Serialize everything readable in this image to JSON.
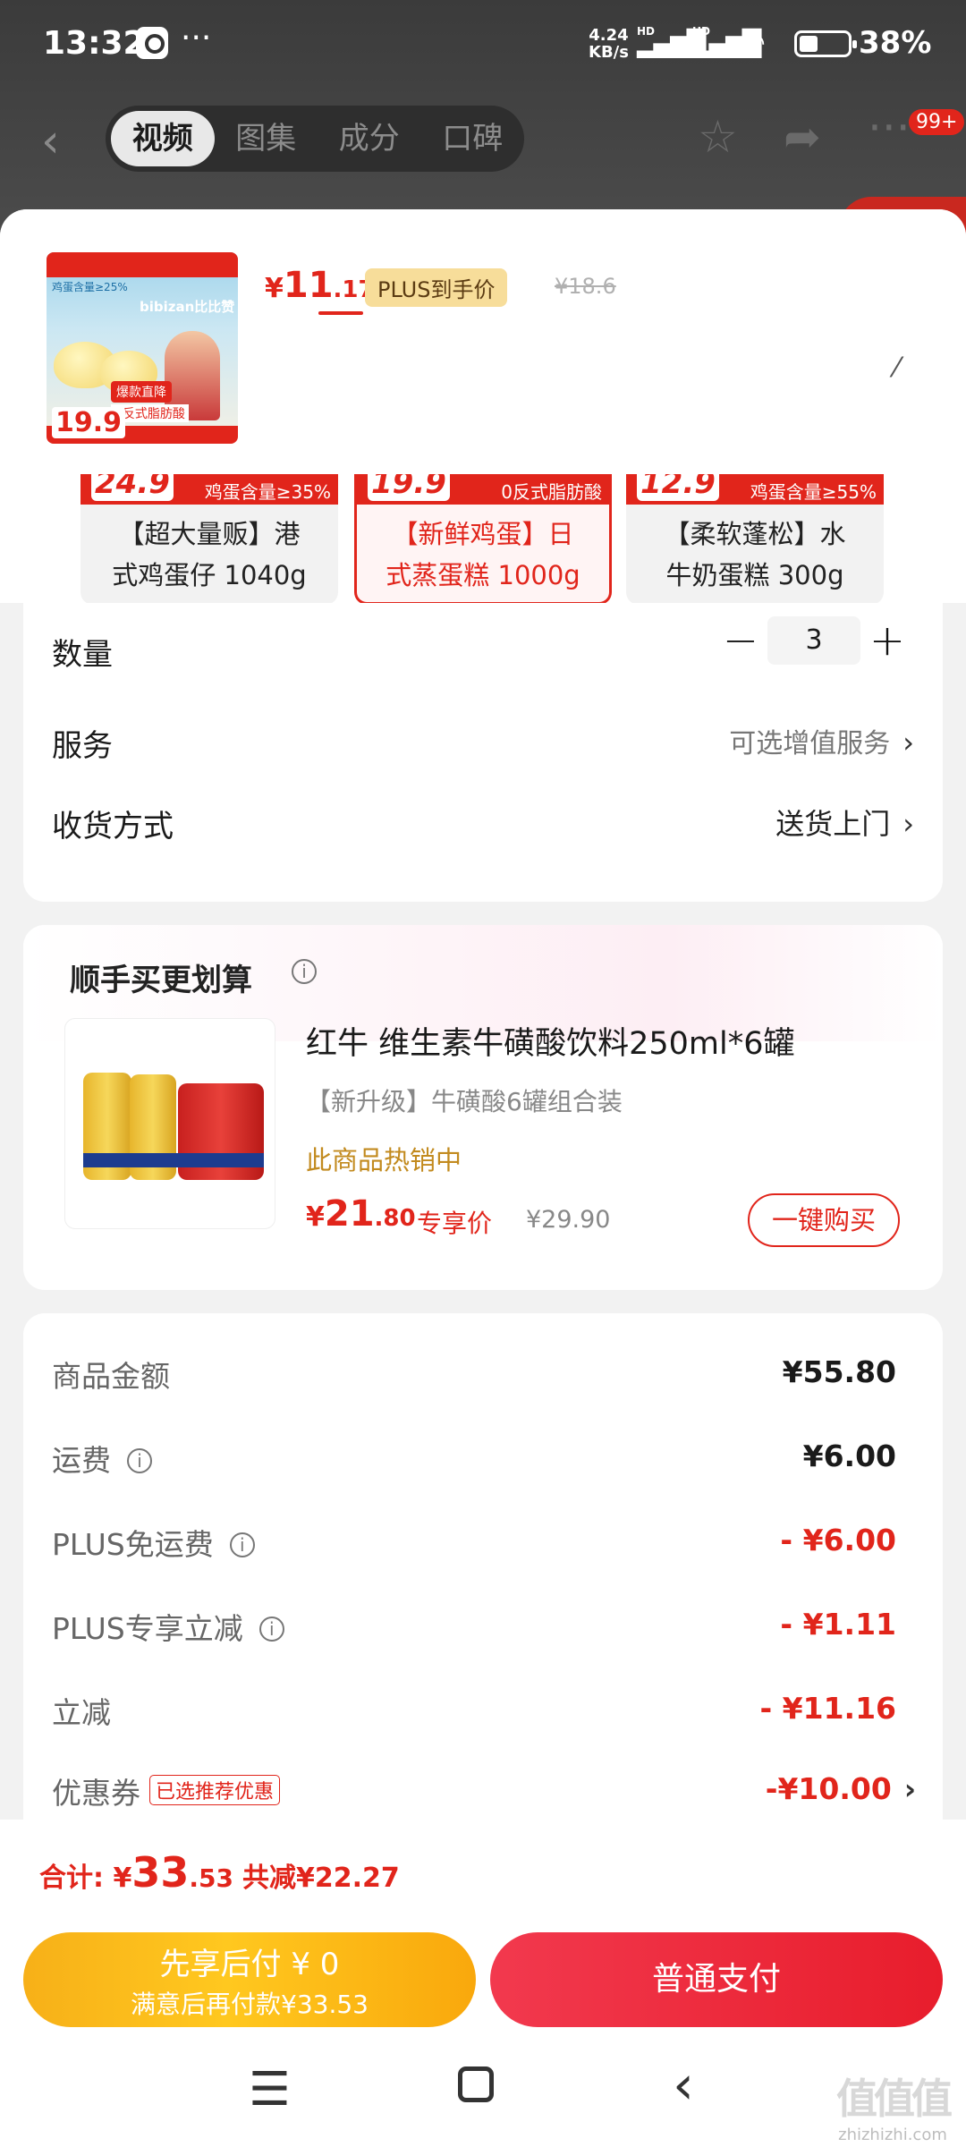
{
  "status": {
    "time": "13:32",
    "dots": "···",
    "speed_top": "4.24",
    "speed_bottom": "KB/s",
    "hd1": "HD",
    "hd2": "HD",
    "wifi_sub": "6",
    "battery": "38%"
  },
  "nav": {
    "tabs": [
      "视频",
      "图集",
      "成分",
      "口碑"
    ],
    "badge": "99+",
    "back_icon": "chevron-left-icon",
    "star_icon": "star-icon",
    "share_icon": "share-icon",
    "more_icon": "more-icon"
  },
  "header": {
    "thumb_price": "19.9",
    "thumb_brand": "bibizan比比赞",
    "thumb_tag": "爆款直降",
    "thumb_sub": "0反式脂肪酸",
    "thumb_badge": "鸡蛋含量≥25%",
    "price_yen": "¥",
    "price_int": "11",
    "price_dec": ".17",
    "plus_label": "PLUS到手价",
    "orig_price": "¥18.6"
  },
  "variants": [
    {
      "num": "24.9",
      "tag": "鸡蛋含量≥35%",
      "name_line1": "【超大量贩】港",
      "name_line2": "式鸡蛋仔 1040g",
      "selected": false
    },
    {
      "num": "19.9",
      "tag": "0反式脂肪酸",
      "name_line1": "【新鲜鸡蛋】日",
      "name_line2": "式蒸蛋糕 1000g",
      "selected": true
    },
    {
      "num": "12.9",
      "tag": "鸡蛋含量≥55%",
      "name_line1": "【柔软蓬松】水",
      "name_line2": "牛奶蛋糕 300g",
      "selected": false
    }
  ],
  "quantity": {
    "label": "数量",
    "minus": "−",
    "value": "3",
    "plus": "+"
  },
  "service": {
    "label": "服务",
    "value": "可选增值服务",
    "chevron": "›"
  },
  "delivery": {
    "label": "收货方式",
    "value": "送货上门",
    "chevron": "›"
  },
  "addon": {
    "title": "顺手买更划算",
    "info": "i",
    "name": "红牛 维生素牛磺酸饮料250ml*6罐",
    "sub": "【新升级】牛磺酸6罐组合装",
    "hot": "此商品热销中",
    "price_yen": "¥",
    "price_int": "21",
    "price_dec": ".80",
    "excl": "专享价",
    "orig": "¥29.90",
    "buy": "一键购买"
  },
  "fees": [
    {
      "label": "商品金额",
      "value": "¥55.80",
      "info": false,
      "red": false,
      "tag": ""
    },
    {
      "label": "运费",
      "value": "¥6.00",
      "info": true,
      "red": false,
      "tag": ""
    },
    {
      "label": "PLUS免运费",
      "value": "- ¥6.00",
      "info": true,
      "red": true,
      "tag": ""
    },
    {
      "label": "PLUS专享立减",
      "value": "- ¥1.11",
      "info": true,
      "red": true,
      "tag": ""
    },
    {
      "label": "立减",
      "value": "- ¥11.16",
      "info": false,
      "red": true,
      "tag": ""
    },
    {
      "label": "优惠券",
      "value": "-¥10.00",
      "info": false,
      "red": true,
      "tag": "已选推荐优惠"
    }
  ],
  "footer": {
    "total_label": "合计:",
    "yen": "¥",
    "total_int": "33",
    "total_dec": ".53",
    "deduct": "共减¥22.27",
    "pay_later_main": "先享后付 ¥ 0",
    "pay_later_sub": "满意后再付款¥33.53",
    "pay_normal": "普通支付"
  },
  "watermark": {
    "logo": "值值值",
    "url": "zhizhizhi.com"
  },
  "colors": {
    "accent": "#e1251b",
    "gold": "#f7b018"
  }
}
